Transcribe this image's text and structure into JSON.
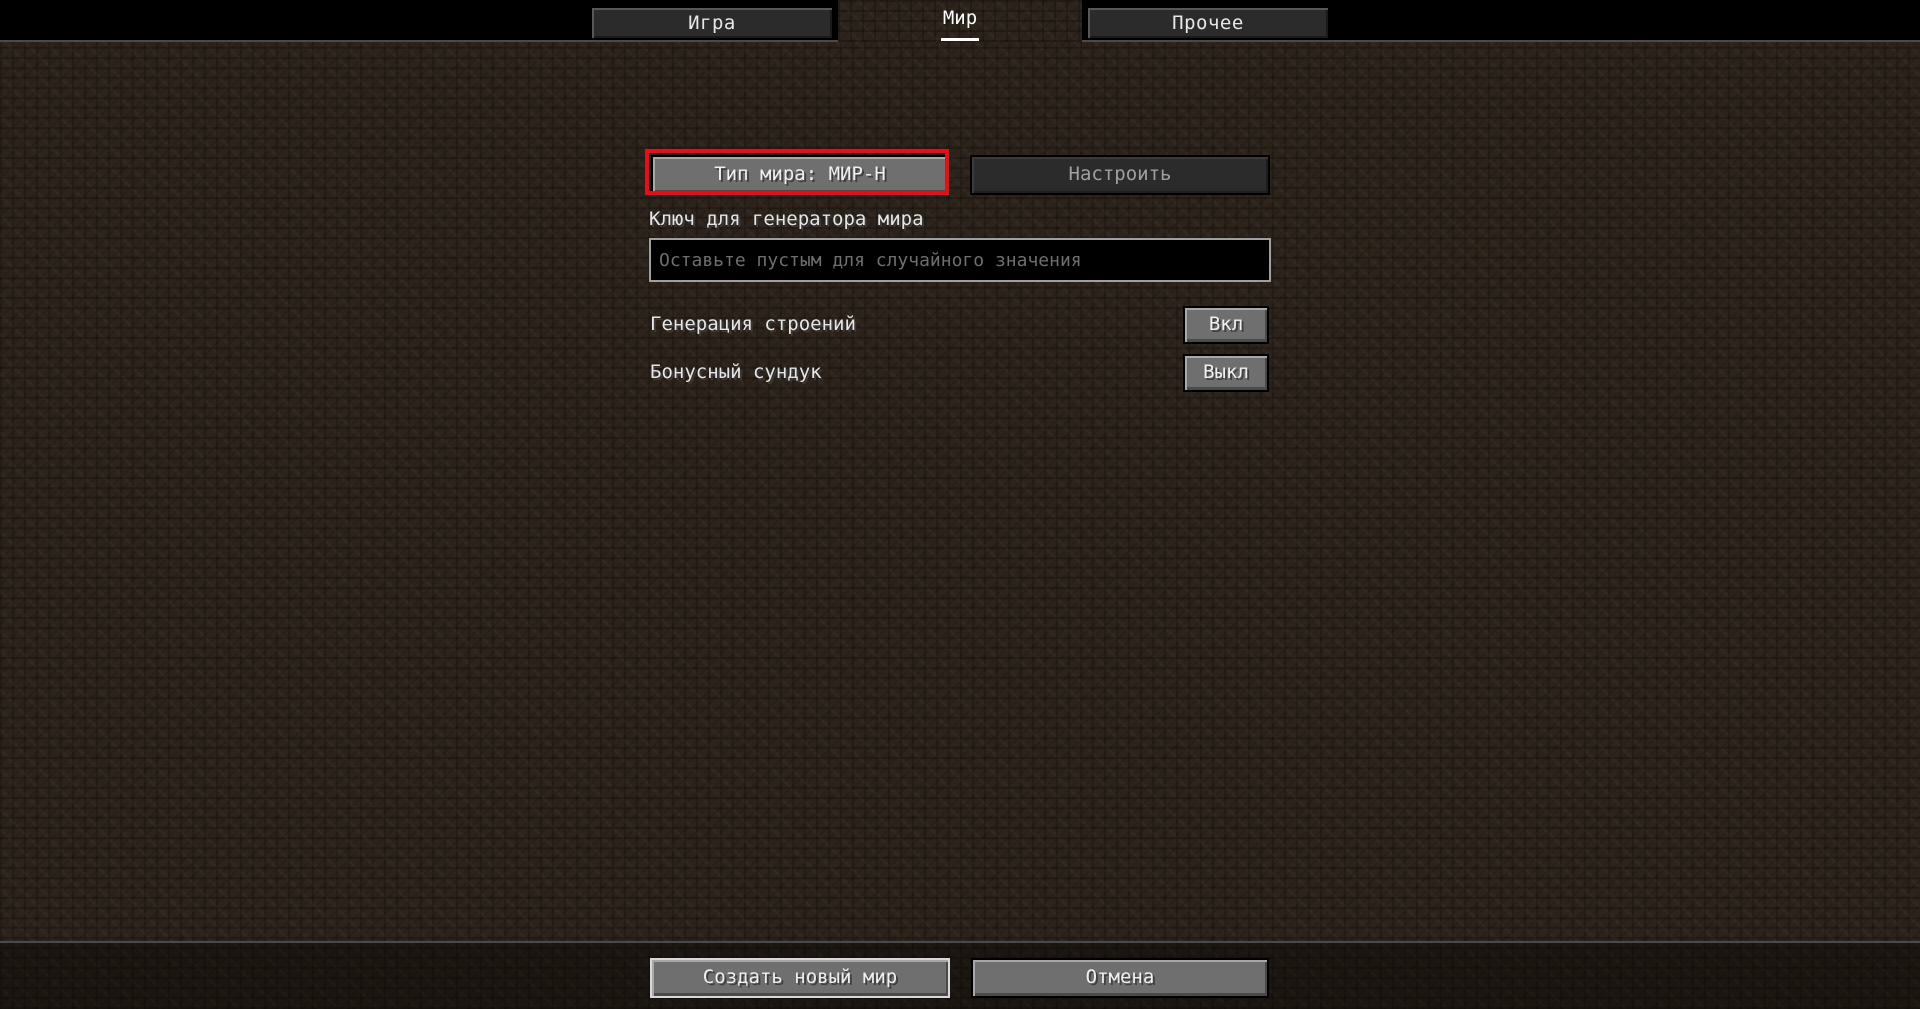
{
  "tabs": {
    "game": "Игра",
    "world": "Мир",
    "other": "Прочее"
  },
  "world": {
    "world_type_button": "Тип мира: МИР-Н",
    "customize_button": "Настроить",
    "seed_label": "Ключ для генератора мира",
    "seed_value": "",
    "seed_placeholder": "Оставьте пустым для случайного значения",
    "structures_label": "Генерация строений",
    "structures_value": "Вкл",
    "bonus_chest_label": "Бонусный сундук",
    "bonus_chest_value": "Выкл"
  },
  "footer": {
    "create_button": "Создать новый мир",
    "cancel_button": "Отмена"
  },
  "colors": {
    "highlight": "#e3101b",
    "background": "#2c231b"
  }
}
